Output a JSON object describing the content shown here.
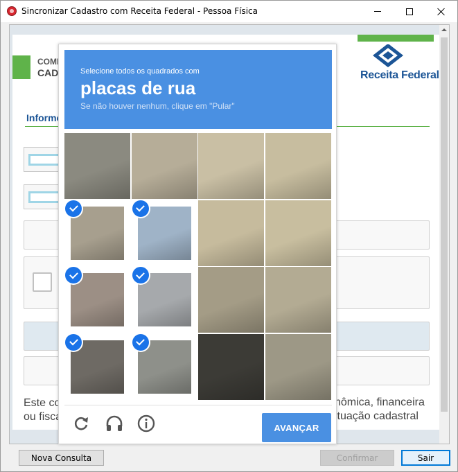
{
  "window": {
    "title": "Sincronizar Cadastro com Receita Federal - Pessoa Física"
  },
  "header": {
    "small": "COMI",
    "big": "CAD",
    "brand": "Receita Federal",
    "section": "Informe"
  },
  "form": {
    "bottom_text_line1": "Este co",
    "bottom_text_line2": "ou fisca",
    "bottom_text_right1": "nômica, financeira",
    "bottom_text_right2": "situação cadastral"
  },
  "captcha": {
    "instruction": "Selecione todos os quadrados com",
    "keyword": "placas de rua",
    "hint": "Se não houver nenhum, clique em \"Pular\"",
    "verify_label": "AVANÇAR",
    "tiles": [
      {
        "row": 0,
        "col": 0,
        "selected": false,
        "color": "#8b8a80"
      },
      {
        "row": 0,
        "col": 1,
        "selected": false,
        "color": "#b6ad98"
      },
      {
        "row": 0,
        "col": 2,
        "selected": false,
        "color": "#c9bfa4"
      },
      {
        "row": 0,
        "col": 3,
        "selected": false,
        "color": "#c7bd9f"
      },
      {
        "row": 1,
        "col": 0,
        "selected": true,
        "color": "#a79f8e"
      },
      {
        "row": 1,
        "col": 1,
        "selected": true,
        "color": "#9fb3c7"
      },
      {
        "row": 1,
        "col": 2,
        "selected": false,
        "color": "#c6bb9d"
      },
      {
        "row": 1,
        "col": 3,
        "selected": false,
        "color": "#c8be9f"
      },
      {
        "row": 2,
        "col": 0,
        "selected": true,
        "color": "#9c8f85"
      },
      {
        "row": 2,
        "col": 1,
        "selected": true,
        "color": "#a6a9ac"
      },
      {
        "row": 2,
        "col": 2,
        "selected": false,
        "color": "#a49c86"
      },
      {
        "row": 2,
        "col": 3,
        "selected": false,
        "color": "#b3ab93"
      },
      {
        "row": 3,
        "col": 0,
        "selected": true,
        "color": "#6e6a64"
      },
      {
        "row": 3,
        "col": 1,
        "selected": true,
        "color": "#8e908a"
      },
      {
        "row": 3,
        "col": 2,
        "selected": false,
        "color": "#3c3b36"
      },
      {
        "row": 3,
        "col": 3,
        "selected": false,
        "color": "#9d9886"
      }
    ]
  },
  "buttons": {
    "new_query": "Nova Consulta",
    "confirm": "Confirmar",
    "exit": "Sair"
  },
  "colors": {
    "captcha_blue": "#4a90e2",
    "brand_green": "#5fb34a",
    "brand_blue": "#1c5596",
    "check_blue": "#1a73e8"
  }
}
